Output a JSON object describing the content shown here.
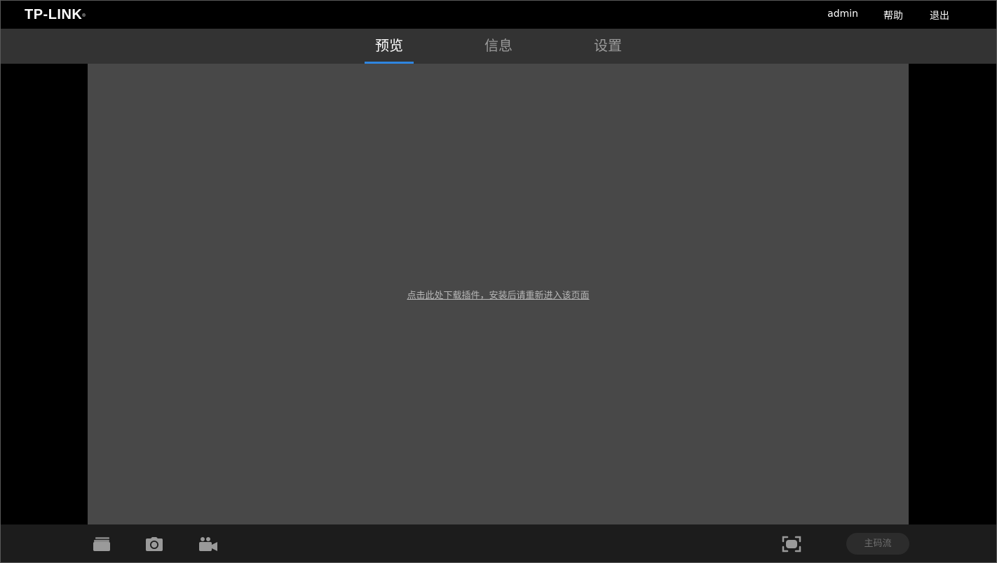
{
  "header": {
    "logo_text": "TP-LINK",
    "logo_mark": "®",
    "user": "admin",
    "help": "帮助",
    "logout": "退出"
  },
  "nav": {
    "tabs": [
      {
        "label": "预览",
        "active": true
      },
      {
        "label": "信息",
        "active": false
      },
      {
        "label": "设置",
        "active": false
      }
    ]
  },
  "video": {
    "plugin_message": "点击此处下载插件，安装后请重新进入该页面"
  },
  "toolbar": {
    "icons": [
      "gallery-icon",
      "camera-icon",
      "video-camera-icon",
      "fullscreen-icon"
    ],
    "stream_label": "主码流"
  },
  "colors": {
    "accent": "#2f86e0",
    "nav_bg": "#333333",
    "video_bg": "#484848",
    "toolbar_bg": "#1c1c1c"
  }
}
